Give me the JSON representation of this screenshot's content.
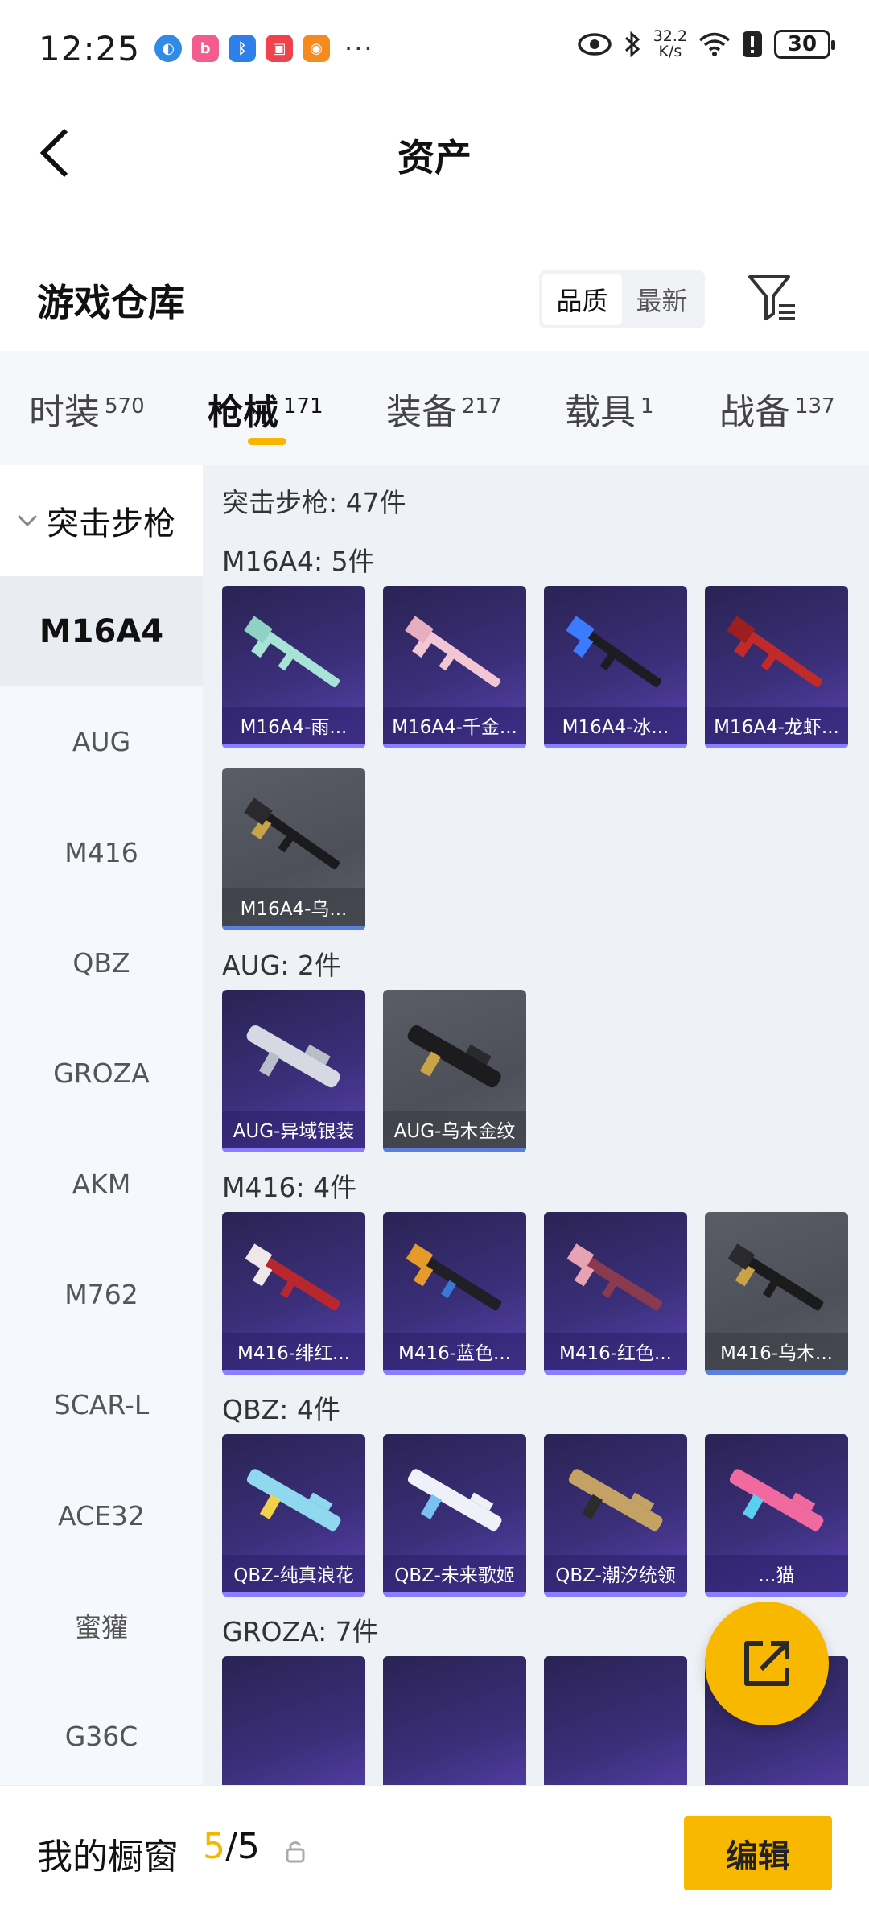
{
  "status_bar": {
    "time": "12:25",
    "speed_top": "32.2",
    "speed_bottom": "K/s",
    "battery": "30",
    "more": "···"
  },
  "header": {
    "title": "资产"
  },
  "warehouse": {
    "title": "游戏仓库",
    "sort_options": [
      "品质",
      "最新"
    ],
    "active_sort": "品质"
  },
  "tabs": [
    {
      "label": "时装",
      "count": "570"
    },
    {
      "label": "枪械",
      "count": "171"
    },
    {
      "label": "装备",
      "count": "217"
    },
    {
      "label": "载具",
      "count": "1"
    },
    {
      "label": "战备",
      "count": "137"
    }
  ],
  "active_tab": "枪械",
  "sidebar": {
    "group": "突击步枪",
    "items": [
      "M16A4",
      "AUG",
      "M416",
      "QBZ",
      "GROZA",
      "AKM",
      "M762",
      "SCAR-L",
      "ACE32",
      "蜜獾",
      "G36C"
    ],
    "active": "M16A4"
  },
  "content": {
    "category_heading": "突击步枪: 47件",
    "groups": [
      {
        "heading": "M16A4: 5件",
        "items": [
          "M16A4-雨...",
          "M16A4-千金...",
          "M16A4-冰...",
          "M16A4-龙虾...",
          "M16A4-乌..."
        ]
      },
      {
        "heading": "AUG: 2件",
        "items": [
          "AUG-异域银装",
          "AUG-乌木金纹"
        ]
      },
      {
        "heading": "M416: 4件",
        "items": [
          "M416-绯红...",
          "M416-蓝色...",
          "M416-红色...",
          "M416-乌木..."
        ]
      },
      {
        "heading": "QBZ: 4件",
        "items": [
          "QBZ-纯真浪花",
          "QBZ-未来歌姬",
          "QBZ-潮汐统领",
          "...猫"
        ]
      },
      {
        "heading": "GROZA: 7件",
        "items": []
      }
    ]
  },
  "bottom": {
    "showcase_label": "我的橱窗",
    "showcase_current": "5",
    "showcase_total": "/5",
    "edit_label": "编辑"
  },
  "colors": {
    "accent": "#f9b800",
    "card_purple": "#3b2f7a",
    "card_gray": "#55585f"
  }
}
